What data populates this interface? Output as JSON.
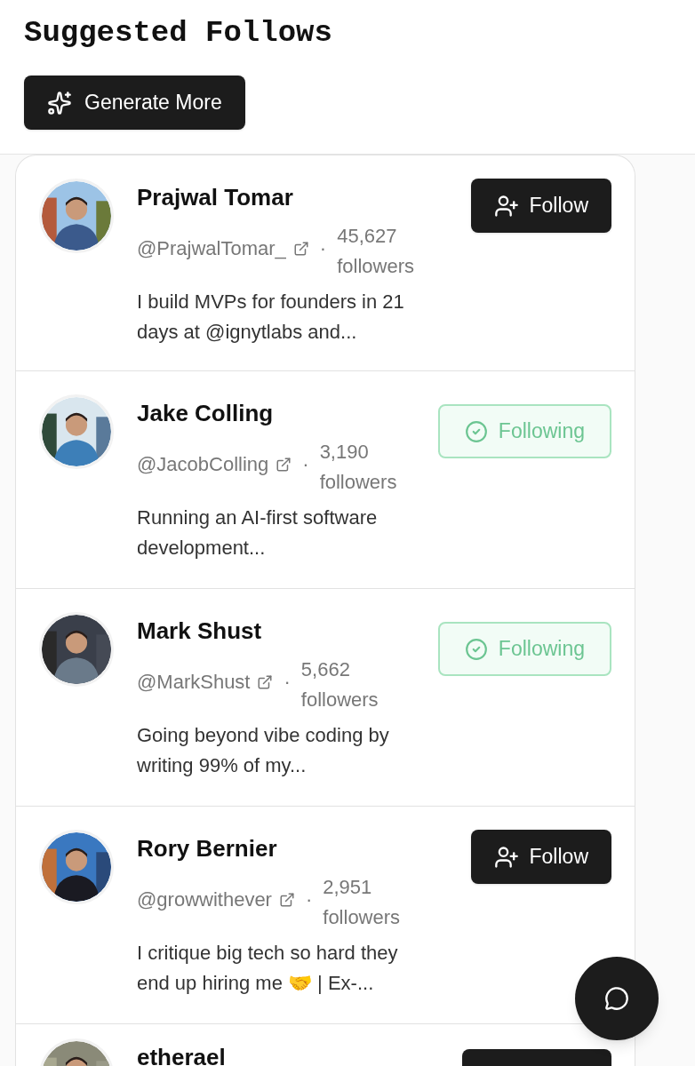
{
  "header": {
    "title": "Suggested Follows",
    "generate_button": "Generate More"
  },
  "users": [
    {
      "name": "Prajwal Tomar",
      "handle": "@PrajwalTomar_",
      "separator": "·",
      "followers": "45,627 followers",
      "bio": "I build MVPs for founders in 21 days at @ignytlabs and...",
      "following": false,
      "button": "Follow"
    },
    {
      "name": "Jake Colling",
      "handle": "@JacobColling",
      "separator": "·",
      "followers": "3,190 followers",
      "bio": "Running an AI-first software development...",
      "following": true,
      "button": "Following"
    },
    {
      "name": "Mark Shust",
      "handle": "@MarkShust",
      "separator": "·",
      "followers": "5,662 followers",
      "bio": "Going beyond vibe coding by writing 99% of my...",
      "following": true,
      "button": "Following"
    },
    {
      "name": "Rory Bernier",
      "handle": "@growwithever",
      "separator": "·",
      "followers": "2,951 followers",
      "bio": "I critique big tech so hard they end up hiring me 🤝 | Ex-...",
      "following": false,
      "button": "Follow"
    },
    {
      "name": "etherael",
      "following": false
    }
  ]
}
